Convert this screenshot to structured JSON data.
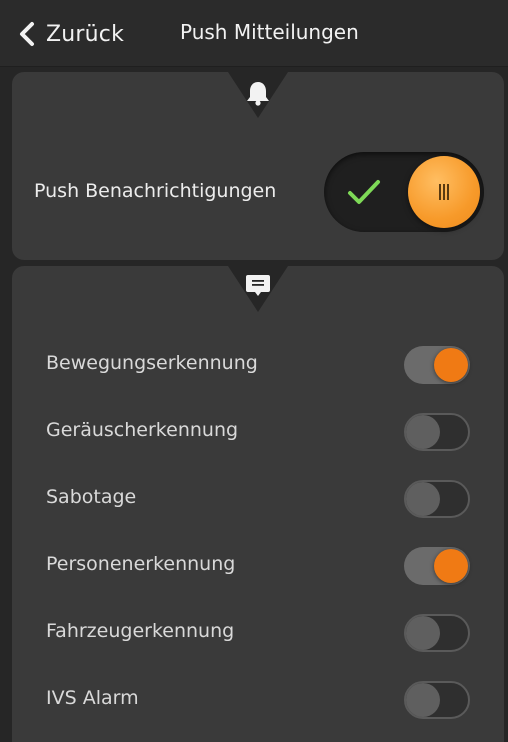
{
  "header": {
    "back_label": "Zurück",
    "title": "Push Mitteilungen"
  },
  "push_card": {
    "icon": "bell-icon",
    "label": "Push Benachrichtigungen",
    "enabled": true,
    "check_icon": "check-icon",
    "accent_color": "#f79a2a",
    "check_color": "#7ed957"
  },
  "list_card": {
    "icon": "message-icon",
    "items": [
      {
        "label": "Bewegungserkennung",
        "on": true
      },
      {
        "label": "Geräuscherkennung",
        "on": false
      },
      {
        "label": "Sabotage",
        "on": false
      },
      {
        "label": "Personenerkennung",
        "on": true
      },
      {
        "label": "Fahrzeugerkennung",
        "on": false
      },
      {
        "label": "IVS Alarm",
        "on": false
      }
    ]
  },
  "colors": {
    "background": "#262626",
    "card": "#3a3a3a",
    "toggle_on": "#f07a14"
  }
}
